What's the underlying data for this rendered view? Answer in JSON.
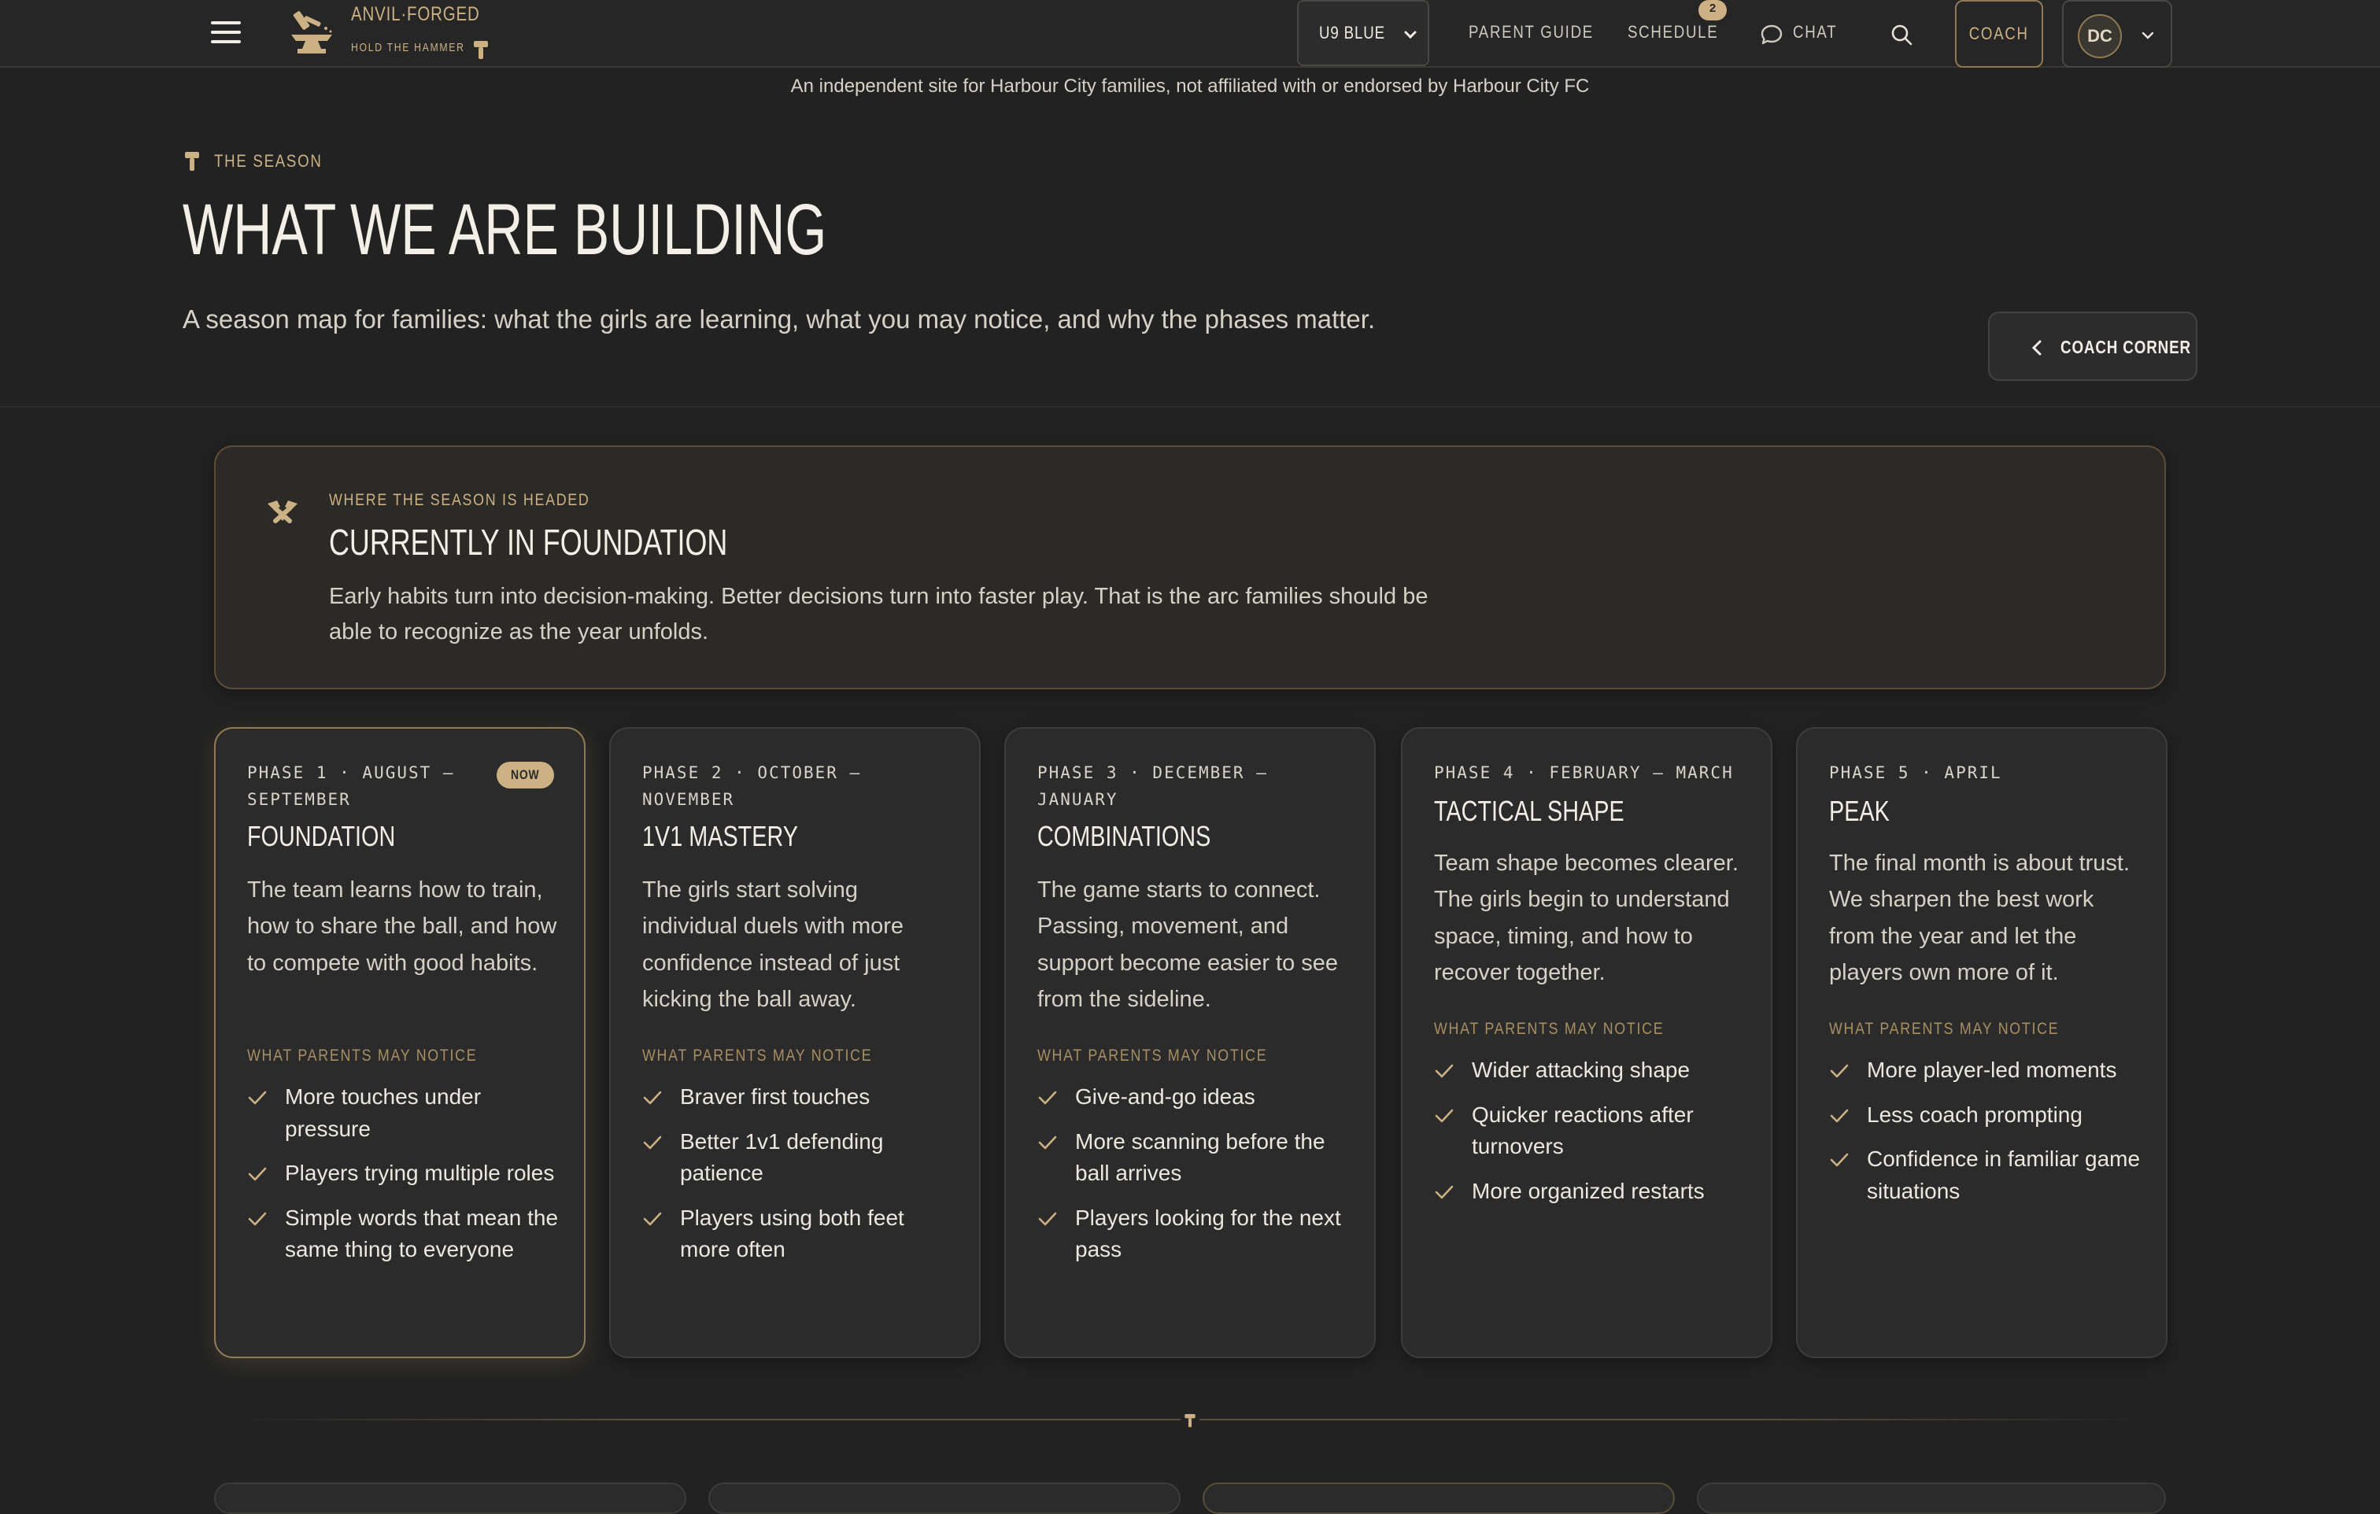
{
  "nav": {
    "brand_name": "ANVIL·FORGED",
    "brand_tag": "HOLD THE HAMMER",
    "team_select": "U9 BLUE",
    "links": {
      "parent_guide": "PARENT GUIDE",
      "schedule": "SCHEDULE",
      "chat": "CHAT"
    },
    "schedule_badge": "2",
    "coach_label": "COACH",
    "avatar_initials": "DC"
  },
  "disclaimer": "An independent site for Harbour City families, not affiliated with or endorsed by Harbour City FC",
  "header": {
    "eyebrow": "THE SEASON",
    "title": "WHAT WE ARE BUILDING",
    "subtitle": "A season map for families: what the girls are learning, what you may notice, and why the phases matter.",
    "corner_button": "COACH CORNER"
  },
  "banner": {
    "eyebrow": "WHERE THE SEASON IS HEADED",
    "title": "CURRENTLY IN FOUNDATION",
    "text": "Early habits turn into decision-making. Better decisions turn into faster play. That is the arc families should be able to recognize as the year unfolds."
  },
  "notice_label": "WHAT PARENTS MAY NOTICE",
  "now_label": "NOW",
  "phases": [
    {
      "meta": "PHASE 1 · AUGUST – SEPTEMBER",
      "title": "FOUNDATION",
      "description": "The team learns how to train, how to share the ball, and how to compete with good habits.",
      "notices": [
        "More touches under pressure",
        "Players trying multiple roles",
        "Simple words that mean the same thing to everyone"
      ],
      "current": true
    },
    {
      "meta": "PHASE 2 · OCTOBER – NOVEMBER",
      "title": "1V1 MASTERY",
      "description": "The girls start solving individual duels with more confidence instead of just kicking the ball away.",
      "notices": [
        "Braver first touches",
        "Better 1v1 defending patience",
        "Players using both feet more often"
      ],
      "current": false
    },
    {
      "meta": "PHASE 3 · DECEMBER – JANUARY",
      "title": "COMBINATIONS",
      "description": "The game starts to connect. Passing, movement, and support become easier to see from the sideline.",
      "notices": [
        "Give-and-go ideas",
        "More scanning before the ball arrives",
        "Players looking for the next pass"
      ],
      "current": false
    },
    {
      "meta": "PHASE 4 · FEBRUARY – MARCH",
      "title": "TACTICAL SHAPE",
      "description": "Team shape becomes clearer. The girls begin to understand space, timing, and how to recover together.",
      "notices": [
        "Wider attacking shape",
        "Quicker reactions after turnovers",
        "More organized restarts"
      ],
      "current": false
    },
    {
      "meta": "PHASE 5 · APRIL",
      "title": "PEAK",
      "description": "The final month is about trust. We sharpen the best work from the year and let the players own more of it.",
      "notices": [
        "More player-led moments",
        "Less coach prompting",
        "Confidence in familiar game situations"
      ],
      "current": false
    }
  ],
  "colors": {
    "background": "#222222",
    "card": "#2b2b2b",
    "accent": "#cbb184",
    "text": "#f3efe6"
  }
}
